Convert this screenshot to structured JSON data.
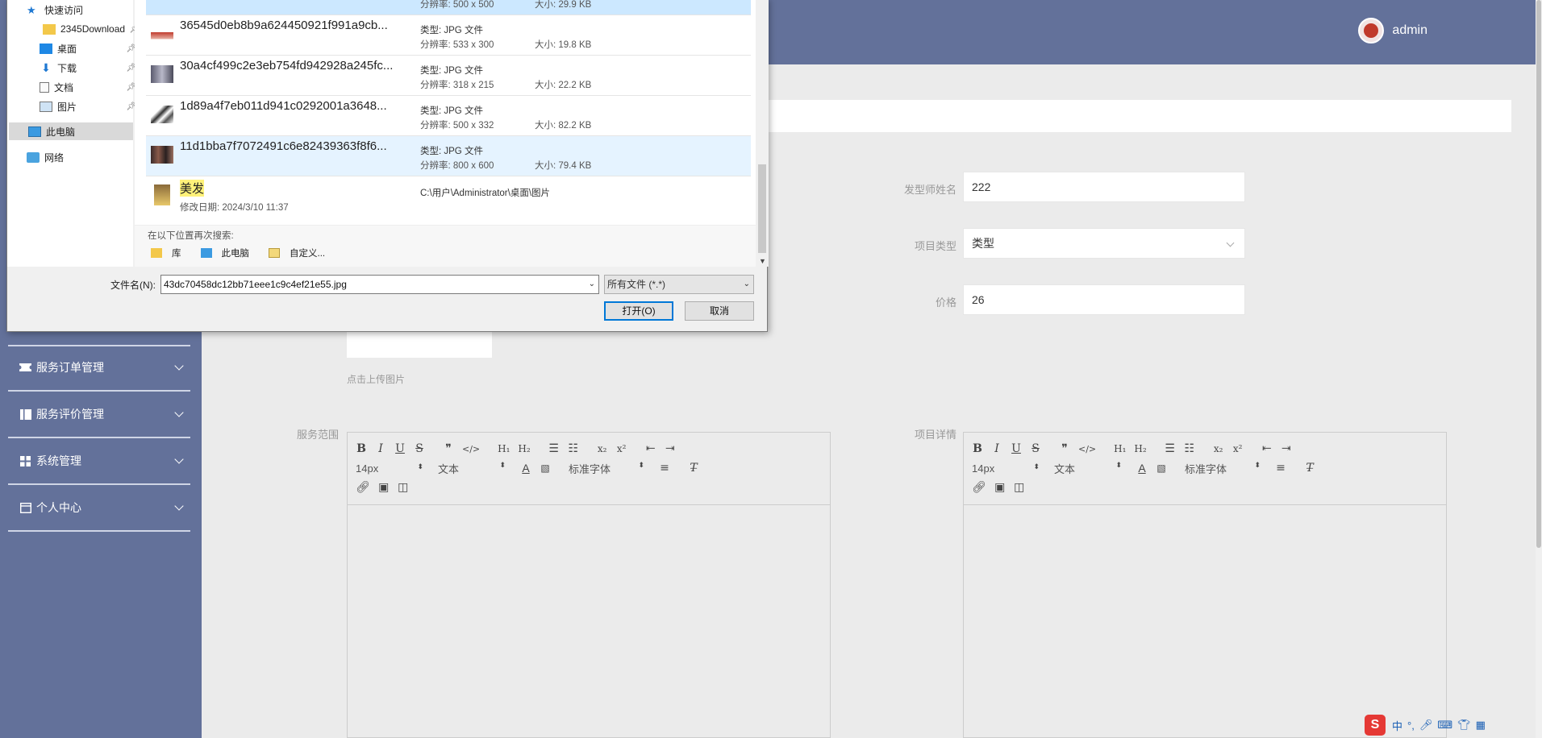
{
  "header": {
    "username": "admin"
  },
  "sidebar": {
    "items": [
      {
        "label": "服务订单管理"
      },
      {
        "label": "服务评价管理"
      },
      {
        "label": "系统管理"
      },
      {
        "label": "个人中心"
      }
    ]
  },
  "form": {
    "stylist_name": {
      "label": "发型师姓名",
      "value": "222"
    },
    "item_type": {
      "label": "项目类型",
      "value": "类型"
    },
    "price": {
      "label": "价格",
      "value": "26"
    },
    "upload_hint": "点击上传图片",
    "service_scope": {
      "label": "服务范围"
    },
    "item_detail": {
      "label": "项目详情"
    }
  },
  "editor": {
    "font_size": "14px",
    "text_style": "文本",
    "font_family": "标准字体"
  },
  "dialog": {
    "nav": [
      {
        "label": "快速访问"
      },
      {
        "label": "2345Download"
      },
      {
        "label": "桌面"
      },
      {
        "label": "下载"
      },
      {
        "label": "文档"
      },
      {
        "label": "图片"
      },
      {
        "label": "此电脑"
      },
      {
        "label": "网络"
      }
    ],
    "partial_row": {
      "res": "分辨率: 500 x 500",
      "size": "大小: 29.9 KB"
    },
    "files": [
      {
        "name": "36545d0eb8b9a624450921f991a9cb...",
        "type": "类型: JPG 文件",
        "res": "分辨率: 533 x 300",
        "size": "大小: 19.8 KB"
      },
      {
        "name": "30a4cf499c2e3eb754fd942928a245fc...",
        "type": "类型: JPG 文件",
        "res": "分辨率: 318 x 215",
        "size": "大小: 22.2 KB"
      },
      {
        "name": "1d89a4f7eb011d941c0292001a3648...",
        "type": "类型: JPG 文件",
        "res": "分辨率: 500 x 332",
        "size": "大小: 82.2 KB"
      },
      {
        "name": "11d1bba7f7072491c6e82439363f8f6...",
        "type": "类型: JPG 文件",
        "res": "分辨率: 800 x 600",
        "size": "大小: 79.4 KB"
      }
    ],
    "folder": {
      "name": "美发",
      "modified": "修改日期: 2024/3/10 11:37",
      "path": "C:\\用户\\Administrator\\桌面\\图片"
    },
    "search_again": "在以下位置再次搜索:",
    "search_locations": [
      {
        "label": "库"
      },
      {
        "label": "此电脑"
      },
      {
        "label": "自定义..."
      }
    ],
    "filename_label": "文件名(N):",
    "filename_value": "43dc70458dc12bb71eee1c9c4ef21e55.jpg",
    "filter": "所有文件 (*.*)",
    "open_button": "打开(O)",
    "cancel_button": "取消"
  },
  "tray": {
    "ime": "中"
  },
  "colors": {
    "sidebar": "#63719a",
    "selected_row": "#cce8ff",
    "highlight": "#fff27a"
  }
}
